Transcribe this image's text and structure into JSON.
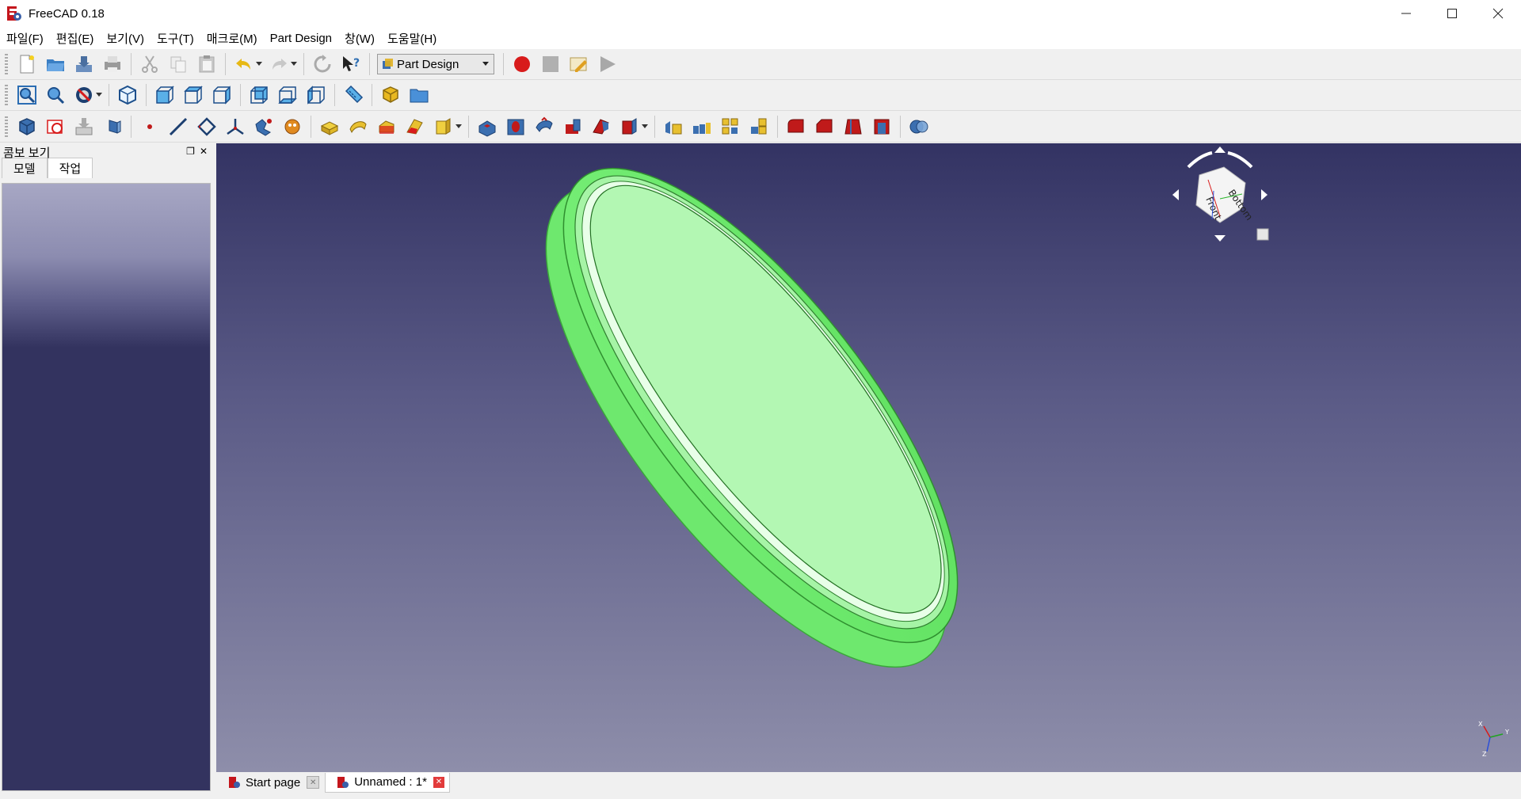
{
  "window": {
    "title": "FreeCAD 0.18",
    "controls": [
      "minimize",
      "maximize",
      "close"
    ]
  },
  "menubar": {
    "items": [
      "파일(F)",
      "편집(E)",
      "보기(V)",
      "도구(T)",
      "매크로(M)",
      "Part Design",
      "창(W)",
      "도움말(H)"
    ]
  },
  "toolbar": {
    "workbench": "Part Design",
    "file_icons": [
      "new-file-icon",
      "open-folder-icon",
      "save-icon",
      "print-icon",
      "cut-icon",
      "copy-icon",
      "paste-icon",
      "undo-icon",
      "redo-icon",
      "refresh-icon",
      "whats-this-icon"
    ],
    "macro_icons": [
      "record-macro-icon",
      "stop-macro-icon",
      "edit-macro-icon",
      "run-macro-icon"
    ],
    "view_icons": [
      "fit-all-icon",
      "fit-selection-icon",
      "draw-style-icon",
      "isometric-icon",
      "front-view-icon",
      "top-view-icon",
      "right-view-icon",
      "rear-view-icon",
      "bottom-view-icon",
      "left-view-icon",
      "measure-icon",
      "part-icon",
      "group-icon"
    ],
    "partdesign_icons": [
      "create-body-icon",
      "create-sketch-icon",
      "attach-icon",
      "clone-icon",
      "datum-point-icon",
      "datum-line-icon",
      "datum-plane-icon",
      "local-cs-icon",
      "shape-binder-icon",
      "subshape-binder-icon",
      "pad-icon",
      "revolution-icon",
      "loft-icon",
      "sweep-icon",
      "additive-primitive-icon",
      "pocket-icon",
      "hole-icon",
      "groove-icon",
      "subtractive-loft-icon",
      "subtractive-pipe-icon",
      "subtractive-primitive-icon",
      "mirrored-icon",
      "linear-pattern-icon",
      "polar-pattern-icon",
      "multitransform-icon",
      "fillet-icon",
      "chamfer-icon",
      "draft-icon",
      "thickness-icon",
      "boolean-icon"
    ]
  },
  "combo_view": {
    "title": "콤보 보기",
    "tabs": [
      "모델",
      "작업"
    ],
    "active_tab": "작업"
  },
  "viewport": {
    "navcube_faces": [
      "Bottom",
      "Front"
    ],
    "model_color": "#7ef27e",
    "axis_labels": [
      "X",
      "Y",
      "Z"
    ]
  },
  "document_tabs": [
    {
      "label": "Start page",
      "active": false
    },
    {
      "label": "Unnamed : 1*",
      "active": true
    }
  ]
}
